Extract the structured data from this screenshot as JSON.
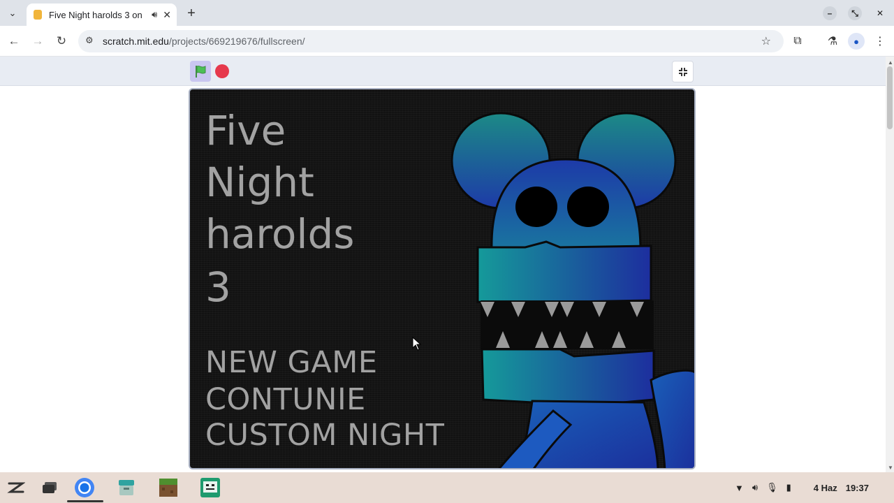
{
  "browser": {
    "tab": {
      "title": "Five Night harolds 3 on",
      "audio_icon": "speaker-icon",
      "close_icon": "close-icon"
    },
    "new_tab_icon": "plus-icon",
    "url_host": "scratch.mit.edu",
    "url_path": "/projects/669219676/fullscreen/",
    "window_controls": [
      "minimize-icon",
      "restore-icon",
      "close-icon"
    ]
  },
  "scratch": {
    "green_flag_icon": "green-flag-icon",
    "stop_icon": "stop-icon",
    "unfullscreen_icon": "unfullscreen-icon"
  },
  "game": {
    "title_lines": [
      "Five",
      "Night",
      "harolds",
      "3"
    ],
    "menu_items": [
      "NEW GAME",
      "CONTUNIE",
      "CUSTOM NIGHT"
    ]
  },
  "shelf": {
    "apps": [
      "launcher-icon",
      "files-icon",
      "chrome-icon",
      "archive-icon",
      "minecraft-icon",
      "screencast-icon"
    ],
    "tray": {
      "date": "4 Haz",
      "time": "19:37"
    }
  },
  "colors": {
    "stage_background": "#121212",
    "game_text": "#a2a2a2",
    "monster_light": "#1a8a8a",
    "monster_dark": "#1d3aa8",
    "stop_red": "#e6394c",
    "flag_green": "#4cbf56"
  }
}
